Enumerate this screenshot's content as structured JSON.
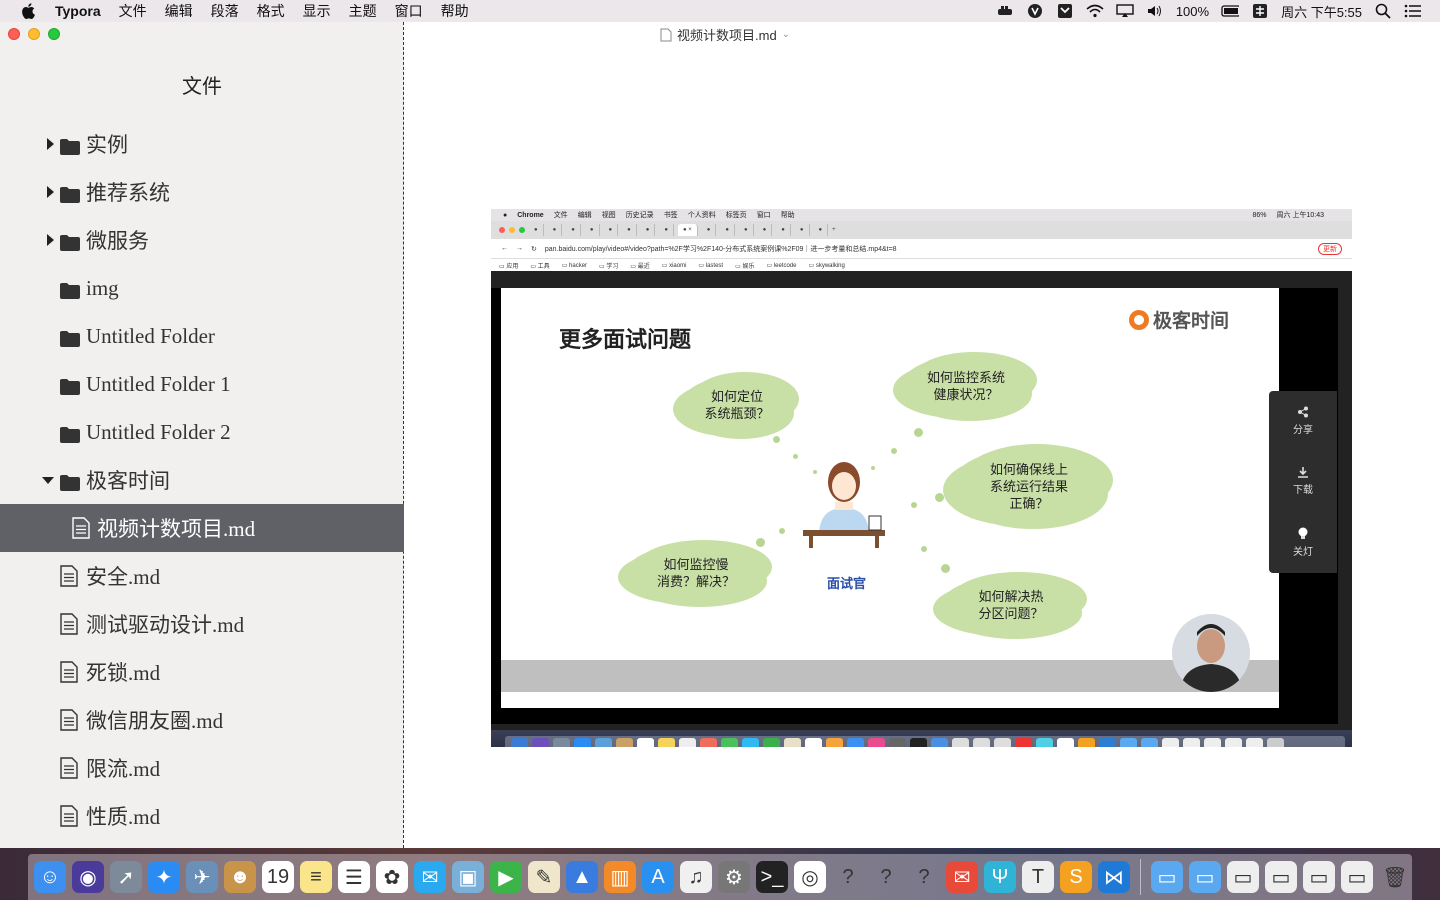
{
  "menubar": {
    "app_name": "Typora",
    "items": [
      "文件",
      "编辑",
      "段落",
      "格式",
      "显示",
      "主题",
      "窗口",
      "帮助"
    ],
    "battery": "100%",
    "clock": "周六 下午5:55"
  },
  "window": {
    "document_title": "视频计数项目.md",
    "sidebar_title": "文件"
  },
  "sidebar": {
    "items": [
      {
        "label": "实例",
        "type": "folder",
        "state": "collapsed"
      },
      {
        "label": "推荐系统",
        "type": "folder",
        "state": "collapsed"
      },
      {
        "label": "微服务",
        "type": "folder",
        "state": "collapsed"
      },
      {
        "label": "img",
        "type": "folder",
        "state": "none"
      },
      {
        "label": "Untitled Folder",
        "type": "folder",
        "state": "none"
      },
      {
        "label": "Untitled Folder 1",
        "type": "folder",
        "state": "none"
      },
      {
        "label": "Untitled Folder 2",
        "type": "folder",
        "state": "none"
      },
      {
        "label": "极客时间",
        "type": "folder",
        "state": "expanded"
      },
      {
        "label": "视频计数项目.md",
        "type": "file",
        "state": "active"
      },
      {
        "label": "安全.md",
        "type": "file",
        "state": "none"
      },
      {
        "label": "测试驱动设计.md",
        "type": "file",
        "state": "none"
      },
      {
        "label": "死锁.md",
        "type": "file",
        "state": "none"
      },
      {
        "label": "微信朋友圈.md",
        "type": "file",
        "state": "none"
      },
      {
        "label": "限流.md",
        "type": "file",
        "state": "none"
      },
      {
        "label": "性质.md",
        "type": "file",
        "state": "none"
      }
    ]
  },
  "screenshot": {
    "menubar_items": [
      "Chrome",
      "文件",
      "编辑",
      "视图",
      "历史记录",
      "书签",
      "个人资料",
      "标签页",
      "窗口",
      "帮助"
    ],
    "menubar_right": "周六 上午10:43",
    "battery": "86%",
    "url": "pan.baidu.com/play/video#/video?path=%2F学习%2F140-分布式系统案例课%2F09｜进一步考量和总结.mp4&t=8",
    "update_button": "更新",
    "bookmarks": [
      "应用",
      "工具",
      "hacker",
      "学习",
      "最近",
      "xiaomi",
      "lastest",
      "娱乐",
      "leetcode",
      "skywalking"
    ],
    "slide_title": "更多面试问题",
    "logo_text": "极客时间",
    "clouds": [
      "如何定位\n系统瓶颈？",
      "如何监控系统\n健康状况？",
      "如何确保线上\n系统运行结果\n正确？",
      "如何监控慢\n消费？解决？",
      "如何解决热\n分区问题？"
    ],
    "interviewer_label": "面试官",
    "side_panel": [
      "分享",
      "下载",
      "关灯"
    ]
  },
  "colors": {
    "sidebar_bg": "#f2f0ee",
    "active_row": "#5f6166",
    "cloud": "#c8dfa6",
    "logo_orange": "#f07a22"
  }
}
